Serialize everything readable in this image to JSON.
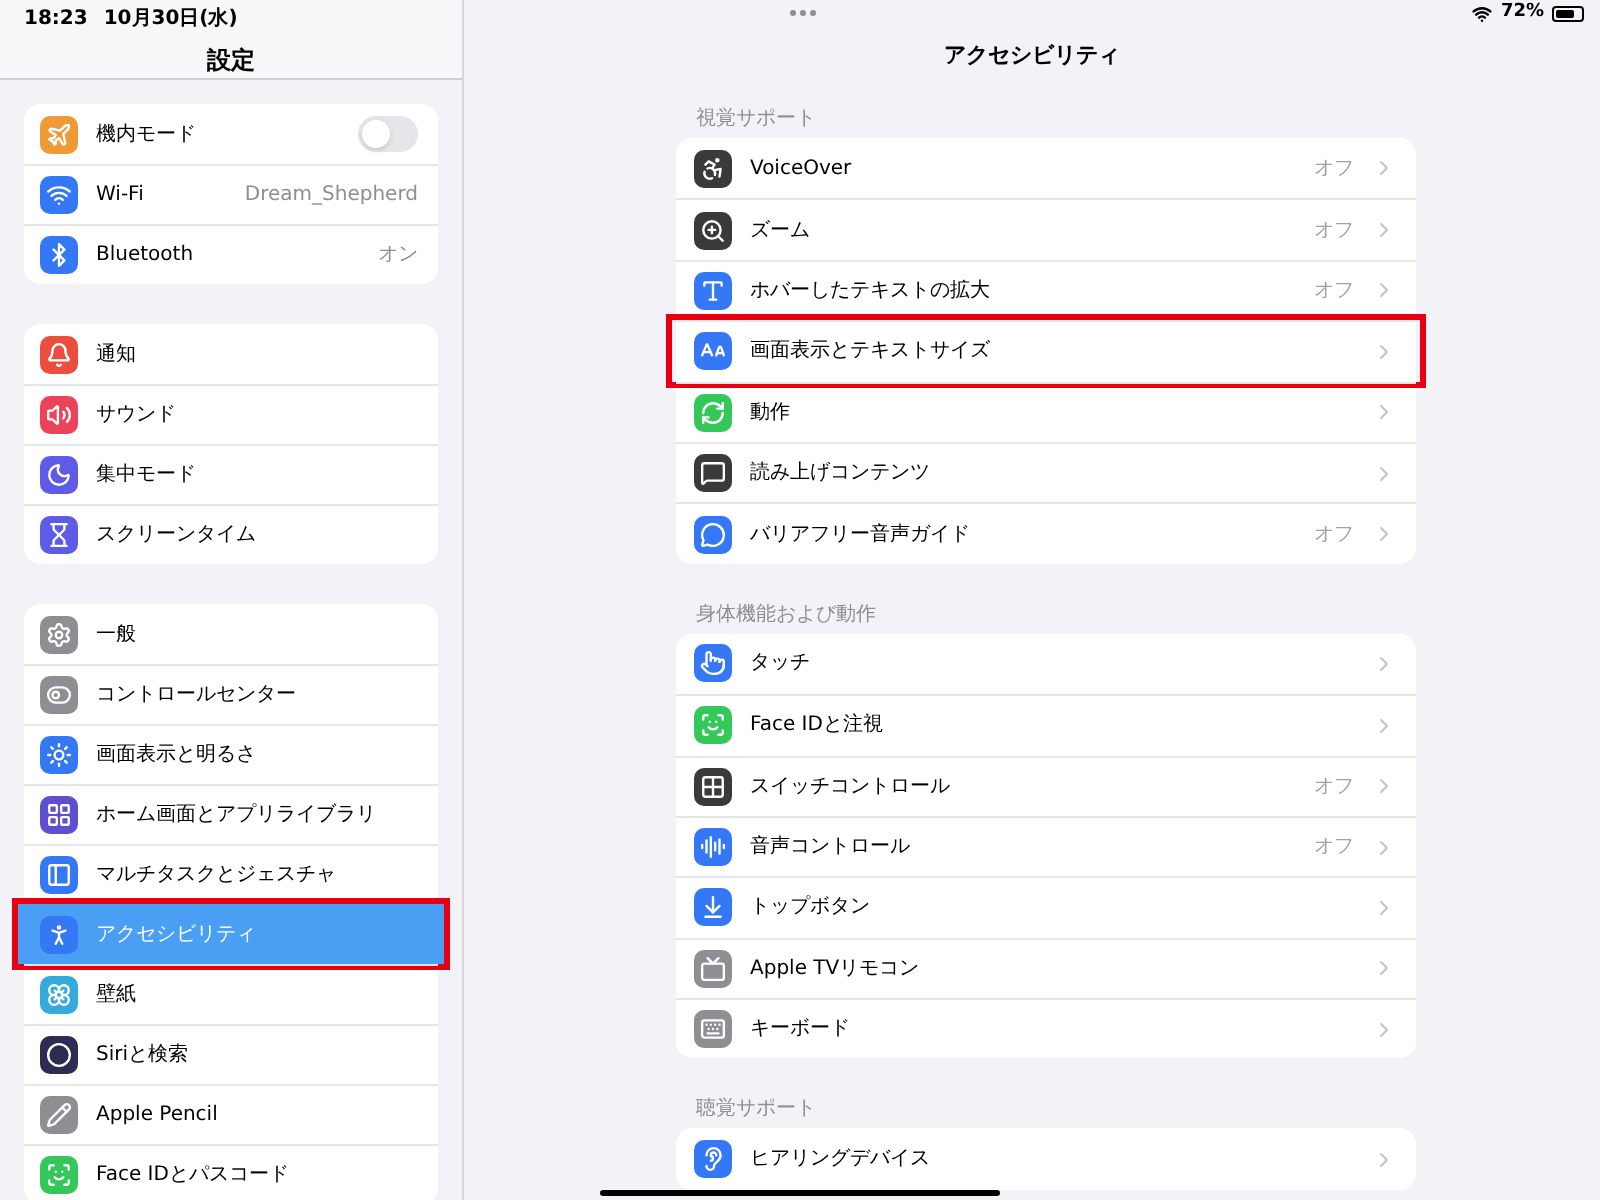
{
  "status_bar": {
    "time": "18:23",
    "date": "10月30日(水)",
    "battery": "72%"
  },
  "sidebar": {
    "title": "設定",
    "groups": [
      {
        "items": [
          {
            "label": "機内モード",
            "kind": "toggle",
            "on": false,
            "selected": false,
            "highlighted": false
          },
          {
            "label": "Wi-Fi",
            "value": "Dream_Shepherd",
            "kind": "link",
            "selected": false,
            "highlighted": false
          },
          {
            "label": "Bluetooth",
            "value": "オン",
            "kind": "link",
            "selected": false,
            "highlighted": false
          }
        ]
      },
      {
        "items": [
          {
            "label": "通知",
            "kind": "link",
            "selected": false,
            "highlighted": false
          },
          {
            "label": "サウンド",
            "kind": "link",
            "selected": false,
            "highlighted": false
          },
          {
            "label": "集中モード",
            "kind": "link",
            "selected": false,
            "highlighted": false
          },
          {
            "label": "スクリーンタイム",
            "kind": "link",
            "selected": false,
            "highlighted": false
          }
        ]
      },
      {
        "items": [
          {
            "label": "一般",
            "kind": "link",
            "selected": false,
            "highlighted": false
          },
          {
            "label": "コントロールセンター",
            "kind": "link",
            "selected": false,
            "highlighted": false
          },
          {
            "label": "画面表示と明るさ",
            "kind": "link",
            "selected": false,
            "highlighted": false
          },
          {
            "label": "ホーム画面とアプリライブラリ",
            "kind": "link",
            "selected": false,
            "highlighted": false
          },
          {
            "label": "マルチタスクとジェスチャ",
            "kind": "link",
            "selected": false,
            "highlighted": false
          },
          {
            "label": "アクセシビリティ",
            "kind": "link",
            "selected": true,
            "highlighted": true
          },
          {
            "label": "壁紙",
            "kind": "link",
            "selected": false,
            "highlighted": false
          },
          {
            "label": "Siriと検索",
            "kind": "link",
            "selected": false,
            "highlighted": false
          },
          {
            "label": "Apple Pencil",
            "kind": "link",
            "selected": false,
            "highlighted": false
          },
          {
            "label": "Face IDとパスコード",
            "kind": "link",
            "selected": false,
            "highlighted": false
          }
        ]
      }
    ]
  },
  "detail": {
    "title": "アクセシビリティ",
    "sections": [
      {
        "header": "視覚サポート",
        "items": [
          {
            "label": "VoiceOver",
            "value": "オフ",
            "highlighted": false
          },
          {
            "label": "ズーム",
            "value": "オフ",
            "highlighted": false
          },
          {
            "label": "ホバーしたテキストの拡大",
            "value": "オフ",
            "highlighted": false
          },
          {
            "label": "画面表示とテキストサイズ",
            "highlighted": true
          },
          {
            "label": "動作",
            "highlighted": false
          },
          {
            "label": "読み上げコンテンツ",
            "highlighted": false
          },
          {
            "label": "バリアフリー音声ガイド",
            "value": "オフ",
            "highlighted": false
          }
        ]
      },
      {
        "header": "身体機能および動作",
        "items": [
          {
            "label": "タッチ",
            "highlighted": false
          },
          {
            "label": "Face IDと注視",
            "highlighted": false
          },
          {
            "label": "スイッチコントロール",
            "value": "オフ",
            "highlighted": false
          },
          {
            "label": "音声コントロール",
            "value": "オフ",
            "highlighted": false
          },
          {
            "label": "トップボタン",
            "highlighted": false
          },
          {
            "label": "Apple TVリモコン",
            "highlighted": false
          },
          {
            "label": "キーボード",
            "highlighted": false
          }
        ]
      },
      {
        "header": "聴覚サポート",
        "items": [
          {
            "label": "ヒアリングデバイス",
            "highlighted": false
          }
        ]
      }
    ]
  }
}
